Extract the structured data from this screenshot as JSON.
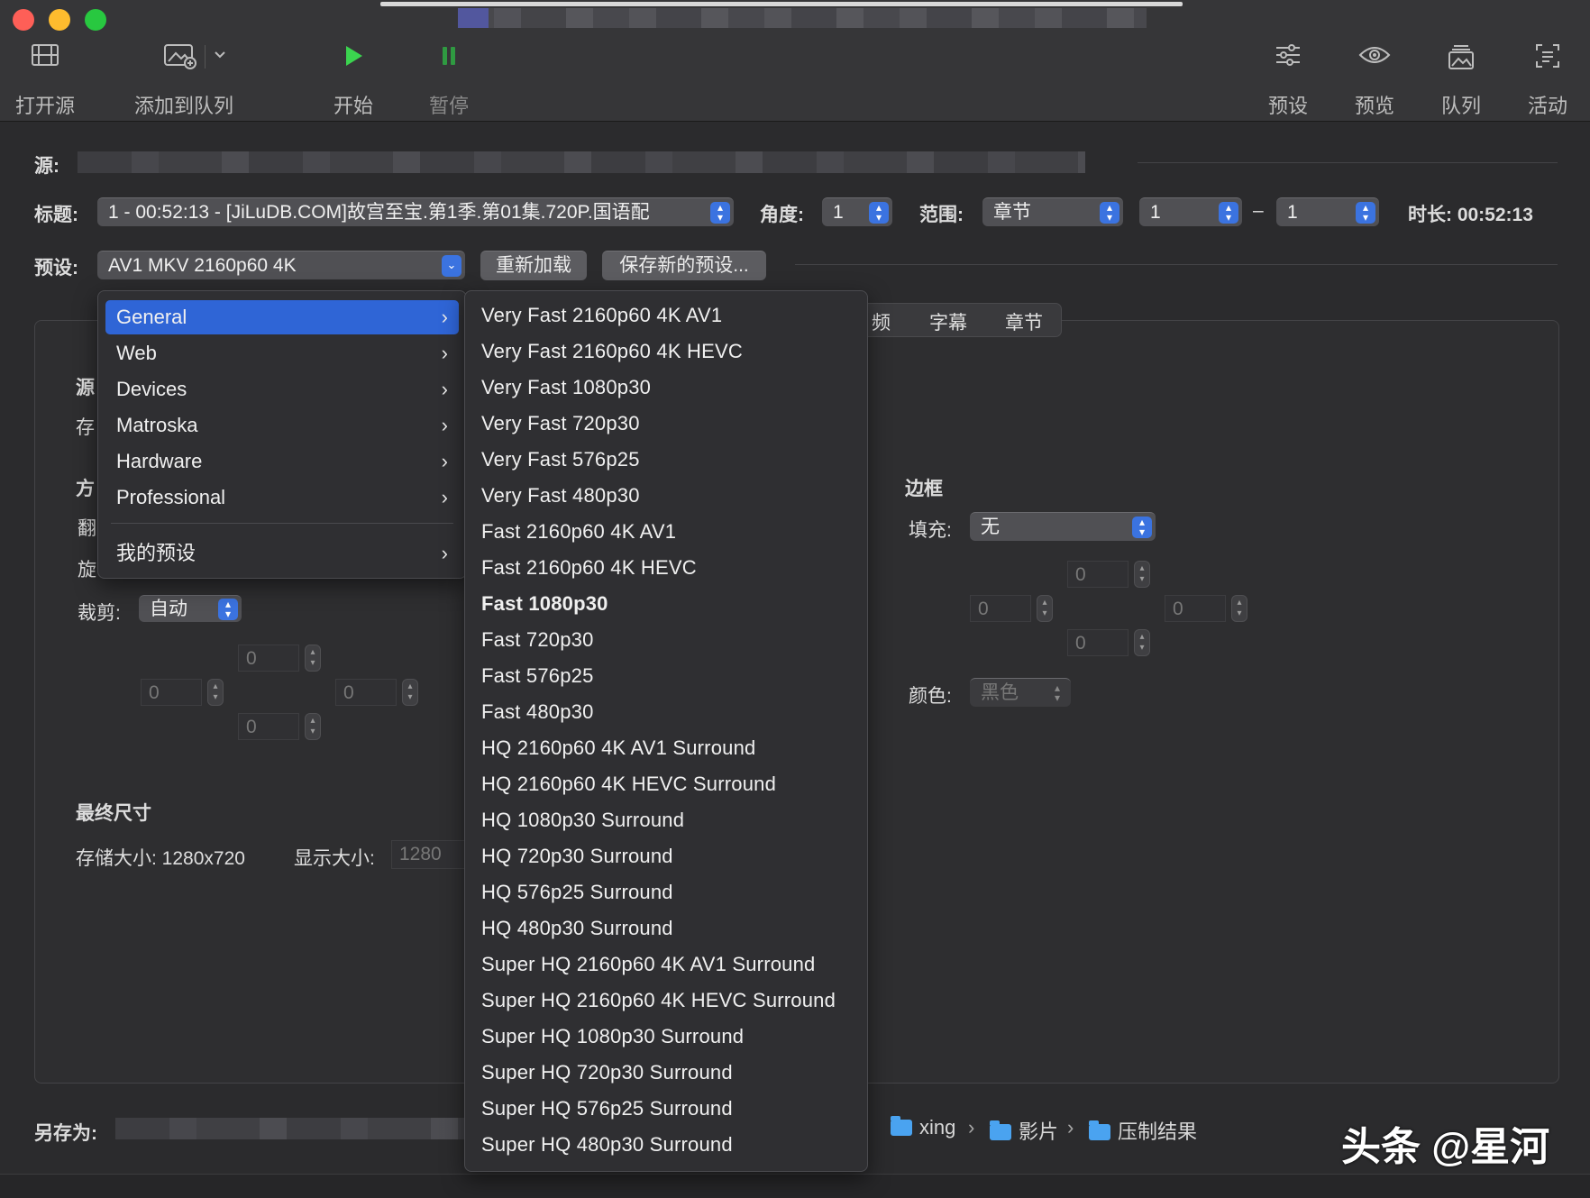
{
  "toolbar": {
    "open_source": "打开源",
    "add_to_queue": "添加到队列",
    "start": "开始",
    "pause": "暂停",
    "presets": "预设",
    "preview": "预览",
    "queue": "队列",
    "activity": "活动",
    "start_color": "#3bd44f",
    "pause_color": "#2f9a41"
  },
  "source": {
    "label": "源:"
  },
  "title_row": {
    "label": "标题:",
    "title_value": "1 - 00:52:13 - [JiLuDB.COM]故宫至宝.第1季.第01集.720P.国语配",
    "angle_label": "角度:",
    "angle_value": "1",
    "range_label": "范围:",
    "range_type": "章节",
    "range_start": "1",
    "range_dash": "–",
    "range_end": "1",
    "duration": "时长: 00:52:13"
  },
  "preset_row": {
    "label": "预设:",
    "preset_value": "AV1 MKV 2160p60 4K",
    "reload_button": "重新加载",
    "save_new_button": "保存新的预设..."
  },
  "tabs": {
    "audio_partial": "频",
    "subtitles": "字幕",
    "chapters": "章节"
  },
  "left_panel": {
    "source_partial": "源",
    "storage_partial": "存",
    "orientation_partial": "方",
    "flip_partial": "翻",
    "rotate_partial": "旋",
    "crop_label": "裁剪:",
    "crop_value": "自动",
    "crop_top": "0",
    "crop_left": "0",
    "crop_right": "0",
    "crop_bottom": "0",
    "final_size_heading": "最终尺寸",
    "storage_size": "存储大小: 1280x720",
    "display_size_label": "显示大小:",
    "display_size_value": "1280"
  },
  "border_panel": {
    "heading": "边框",
    "fill_label": "填充:",
    "fill_value": "无",
    "top": "0",
    "left": "0",
    "right": "0",
    "bottom": "0",
    "color_label": "颜色:",
    "color_value": "黑色"
  },
  "category_menu": [
    {
      "label": "General",
      "selected": true
    },
    {
      "label": "Web"
    },
    {
      "label": "Devices"
    },
    {
      "label": "Matroska"
    },
    {
      "label": "Hardware"
    },
    {
      "label": "Professional"
    },
    {
      "label": "我的预设"
    }
  ],
  "preset_menu": [
    "Very Fast 2160p60 4K AV1",
    "Very Fast 2160p60 4K HEVC",
    "Very Fast 1080p30",
    "Very Fast 720p30",
    "Very Fast 576p25",
    "Very Fast 480p30",
    "Fast 2160p60 4K AV1",
    "Fast 2160p60 4K HEVC",
    "Fast 1080p30",
    "Fast 720p30",
    "Fast 576p25",
    "Fast 480p30",
    "HQ 2160p60 4K AV1 Surround",
    "HQ 2160p60 4K HEVC Surround",
    "HQ 1080p30 Surround",
    "HQ 720p30 Surround",
    "HQ 576p25 Surround",
    "HQ 480p30 Surround",
    "Super HQ 2160p60 4K AV1 Surround",
    "Super HQ 2160p60 4K HEVC Surround",
    "Super HQ 1080p30 Surround",
    "Super HQ 720p30 Surround",
    "Super HQ 576p25 Surround",
    "Super HQ 480p30 Surround"
  ],
  "preset_menu_bold_item": "Fast 1080p30",
  "save_as": {
    "label": "另存为:",
    "path": [
      "xing",
      "影片",
      "压制结果"
    ],
    "separator": "›"
  },
  "watermark": "头条 @星河",
  "colors": {
    "accent": "#2f65d6",
    "folder": "#4aa3f0"
  }
}
